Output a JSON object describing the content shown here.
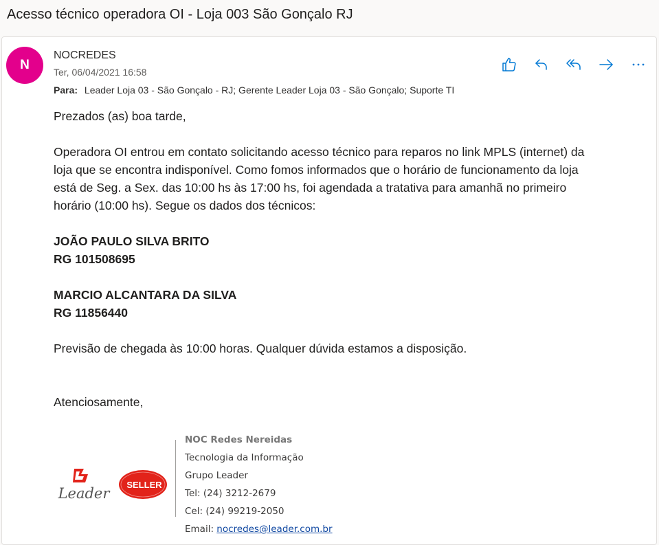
{
  "subject": "Acesso técnico operadora OI - Loja 003 São Gonçalo RJ",
  "message": {
    "avatar_initial": "N",
    "sender": "NOCREDES",
    "date": "Ter, 06/04/2021 16:58",
    "to_label": "Para:",
    "to_value": "Leader Loja 03 - São Gonçalo - RJ; Gerente Leader Loja 03 - São Gonçalo; Suporte TI"
  },
  "actions": [
    {
      "name": "like",
      "icon": "thumbs-up-icon"
    },
    {
      "name": "reply",
      "icon": "reply-icon"
    },
    {
      "name": "reply-all",
      "icon": "reply-all-icon"
    },
    {
      "name": "forward",
      "icon": "forward-icon"
    },
    {
      "name": "more",
      "icon": "more-icon"
    }
  ],
  "body": {
    "greeting": "Prezados (as) boa tarde,",
    "para1": [
      "Operadora OI entrou em contato solicitando acesso técnico para reparos no link MPLS (internet) da",
      "loja que se encontra indisponível. Como fomos informados que o horário de funcionamento da loja",
      "está de Seg. a Sex. das 10:00 hs às 17:00 hs, foi agendada a tratativa para amanhã no primeiro",
      "horário (10:00 hs). Segue os dados dos técnicos:"
    ],
    "tech1_name": "JOÃO PAULO SILVA BRITO",
    "tech1_rg": "RG 101508695",
    "tech2_name": "MARCIO ALCANTARA DA SILVA",
    "tech2_rg": "RG 11856440",
    "eta": "Previsão de chegada às 10:00 horas. Qualquer dúvida estamos a disposição.",
    "closing": "Atenciosamente,"
  },
  "signature": {
    "name": "NOC Redes Nereidas",
    "dept": "Tecnologia da Informação",
    "company": "Grupo Leader",
    "tel": "Tel: (24) 3212-2679",
    "cel": "Cel: (24) 99219-2050",
    "email_label": "Email: ",
    "email": "nocredes@leader.com.br",
    "logo1_text": "Leader",
    "logo2_text": "SELLER"
  },
  "colors": {
    "avatar": "#e3008c",
    "accent": "#0078d4",
    "logo_red": "#e2231a"
  }
}
